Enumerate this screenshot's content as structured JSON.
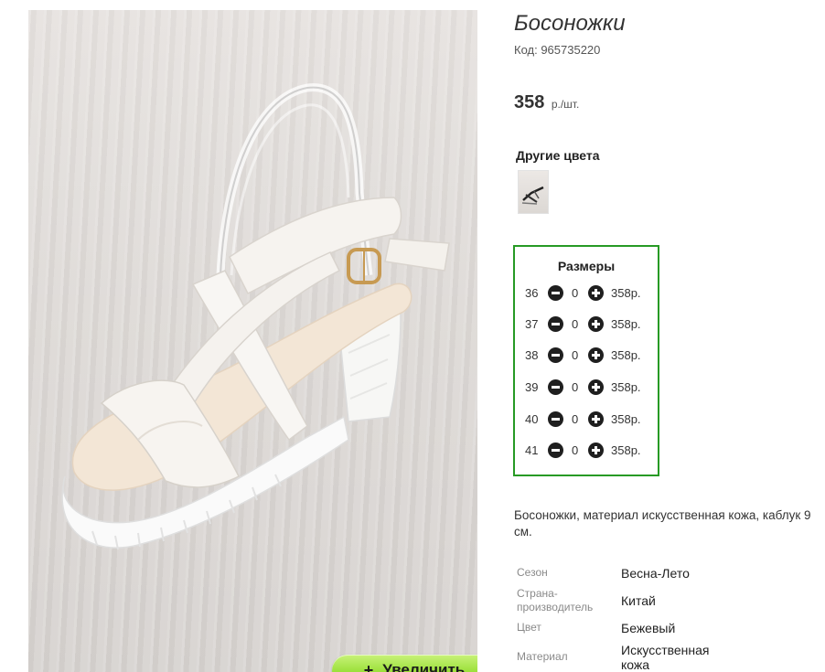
{
  "product": {
    "title": "Босоножки",
    "code": "Код: 965735220",
    "price_value": "358",
    "price_unit": "р./шт."
  },
  "zoom_button": {
    "icon": "plus-icon",
    "label": "Увеличить"
  },
  "other_colors": {
    "label": "Другие цвета"
  },
  "sizes": {
    "title": "Размеры",
    "rows": [
      {
        "size": "36",
        "qty": "0",
        "price": "358р."
      },
      {
        "size": "37",
        "qty": "0",
        "price": "358р."
      },
      {
        "size": "38",
        "qty": "0",
        "price": "358р."
      },
      {
        "size": "39",
        "qty": "0",
        "price": "358р."
      },
      {
        "size": "40",
        "qty": "0",
        "price": "358р."
      },
      {
        "size": "41",
        "qty": "0",
        "price": "358р."
      }
    ]
  },
  "description": "Босоножки, материал искусственная кожа, каблук 9 см.",
  "specs": [
    {
      "label": "Сезон",
      "value": "Весна-Лето"
    },
    {
      "label": "Страна-производитель",
      "value": "Китай"
    },
    {
      "label": "Цвет",
      "value": "Бежевый"
    },
    {
      "label": "Материал",
      "value": "Искусственная кожа"
    }
  ],
  "colors": {
    "sizes_border": "#279a24",
    "zoom_button": "#9be03a",
    "stepper_icon": "#1f1f1f"
  }
}
